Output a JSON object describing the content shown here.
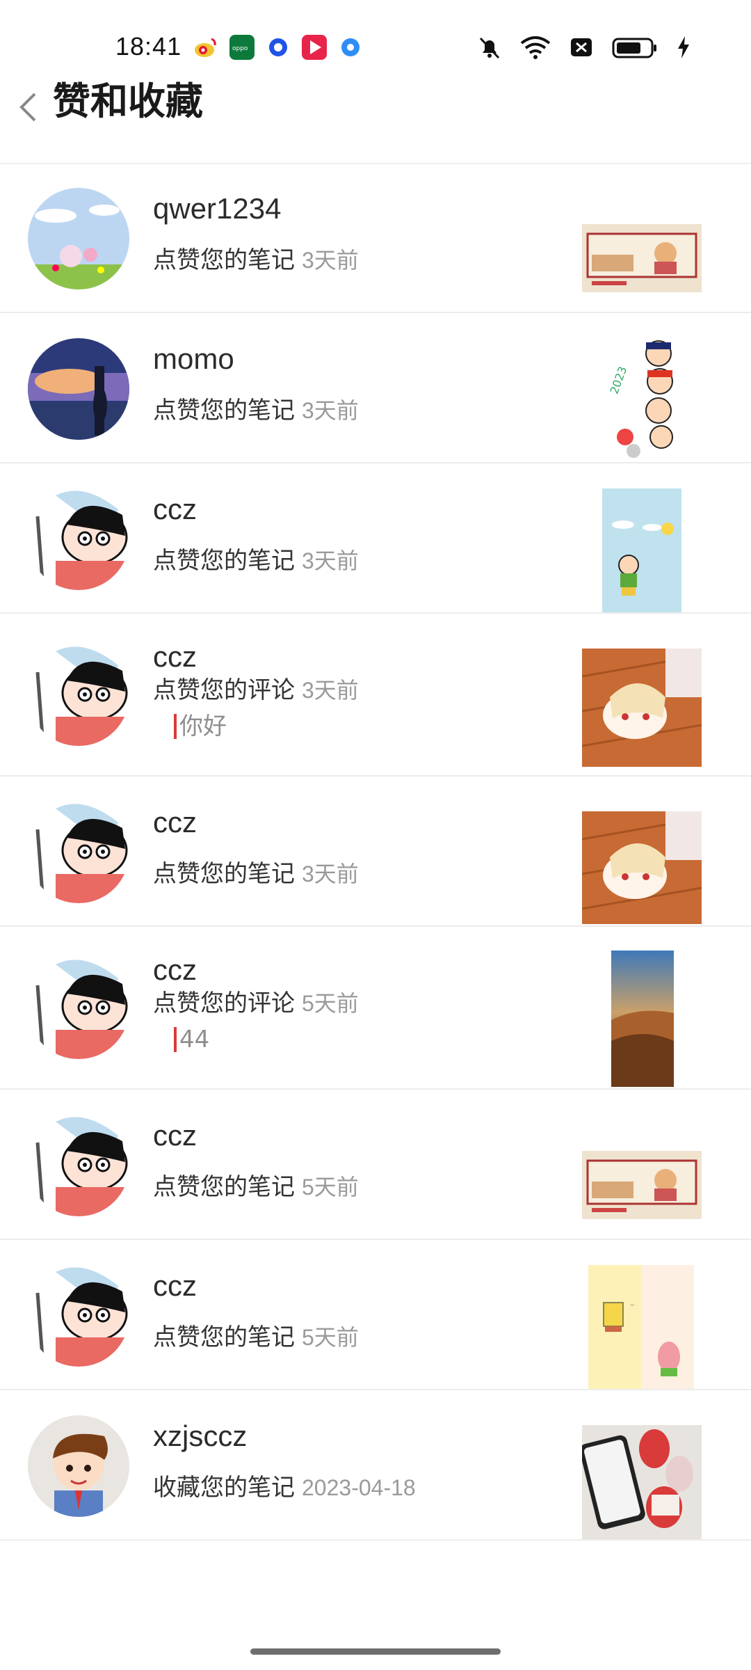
{
  "status_bar": {
    "time": "18:41",
    "app_icons": [
      "weibo-icon",
      "oppo-icon",
      "blue-circle-icon",
      "video-icon",
      "blue-dot-icon"
    ],
    "status_icons": [
      "mute-bell-icon",
      "wifi-icon",
      "sim-off-icon",
      "battery-icon",
      "charging-icon"
    ]
  },
  "header": {
    "title": "赞和收藏",
    "back_icon": "chevron-left-icon"
  },
  "items": [
    {
      "username": "qwer1234",
      "action": "点赞您的笔记",
      "time": "3天前"
    },
    {
      "username": "momo",
      "action": "点赞您的笔记",
      "time": "3天前"
    },
    {
      "username": "ccz",
      "action": "点赞您的笔记",
      "time": "3天前"
    },
    {
      "username": "ccz",
      "action": "点赞您的评论",
      "time": "3天前",
      "comment": "你好"
    },
    {
      "username": "ccz",
      "action": "点赞您的笔记",
      "time": "3天前"
    },
    {
      "username": "ccz",
      "action": "点赞您的评论",
      "time": "5天前",
      "comment": "44"
    },
    {
      "username": "ccz",
      "action": "点赞您的笔记",
      "time": "5天前"
    },
    {
      "username": "ccz",
      "action": "点赞您的笔记",
      "time": "5天前"
    },
    {
      "username": "xzjsccz",
      "action": "收藏您的笔记",
      "time": "2023-04-18"
    }
  ],
  "colors": {
    "accent_red": "#d93a3a",
    "secondary_text": "#9a9a9a",
    "divider": "#ececec"
  }
}
